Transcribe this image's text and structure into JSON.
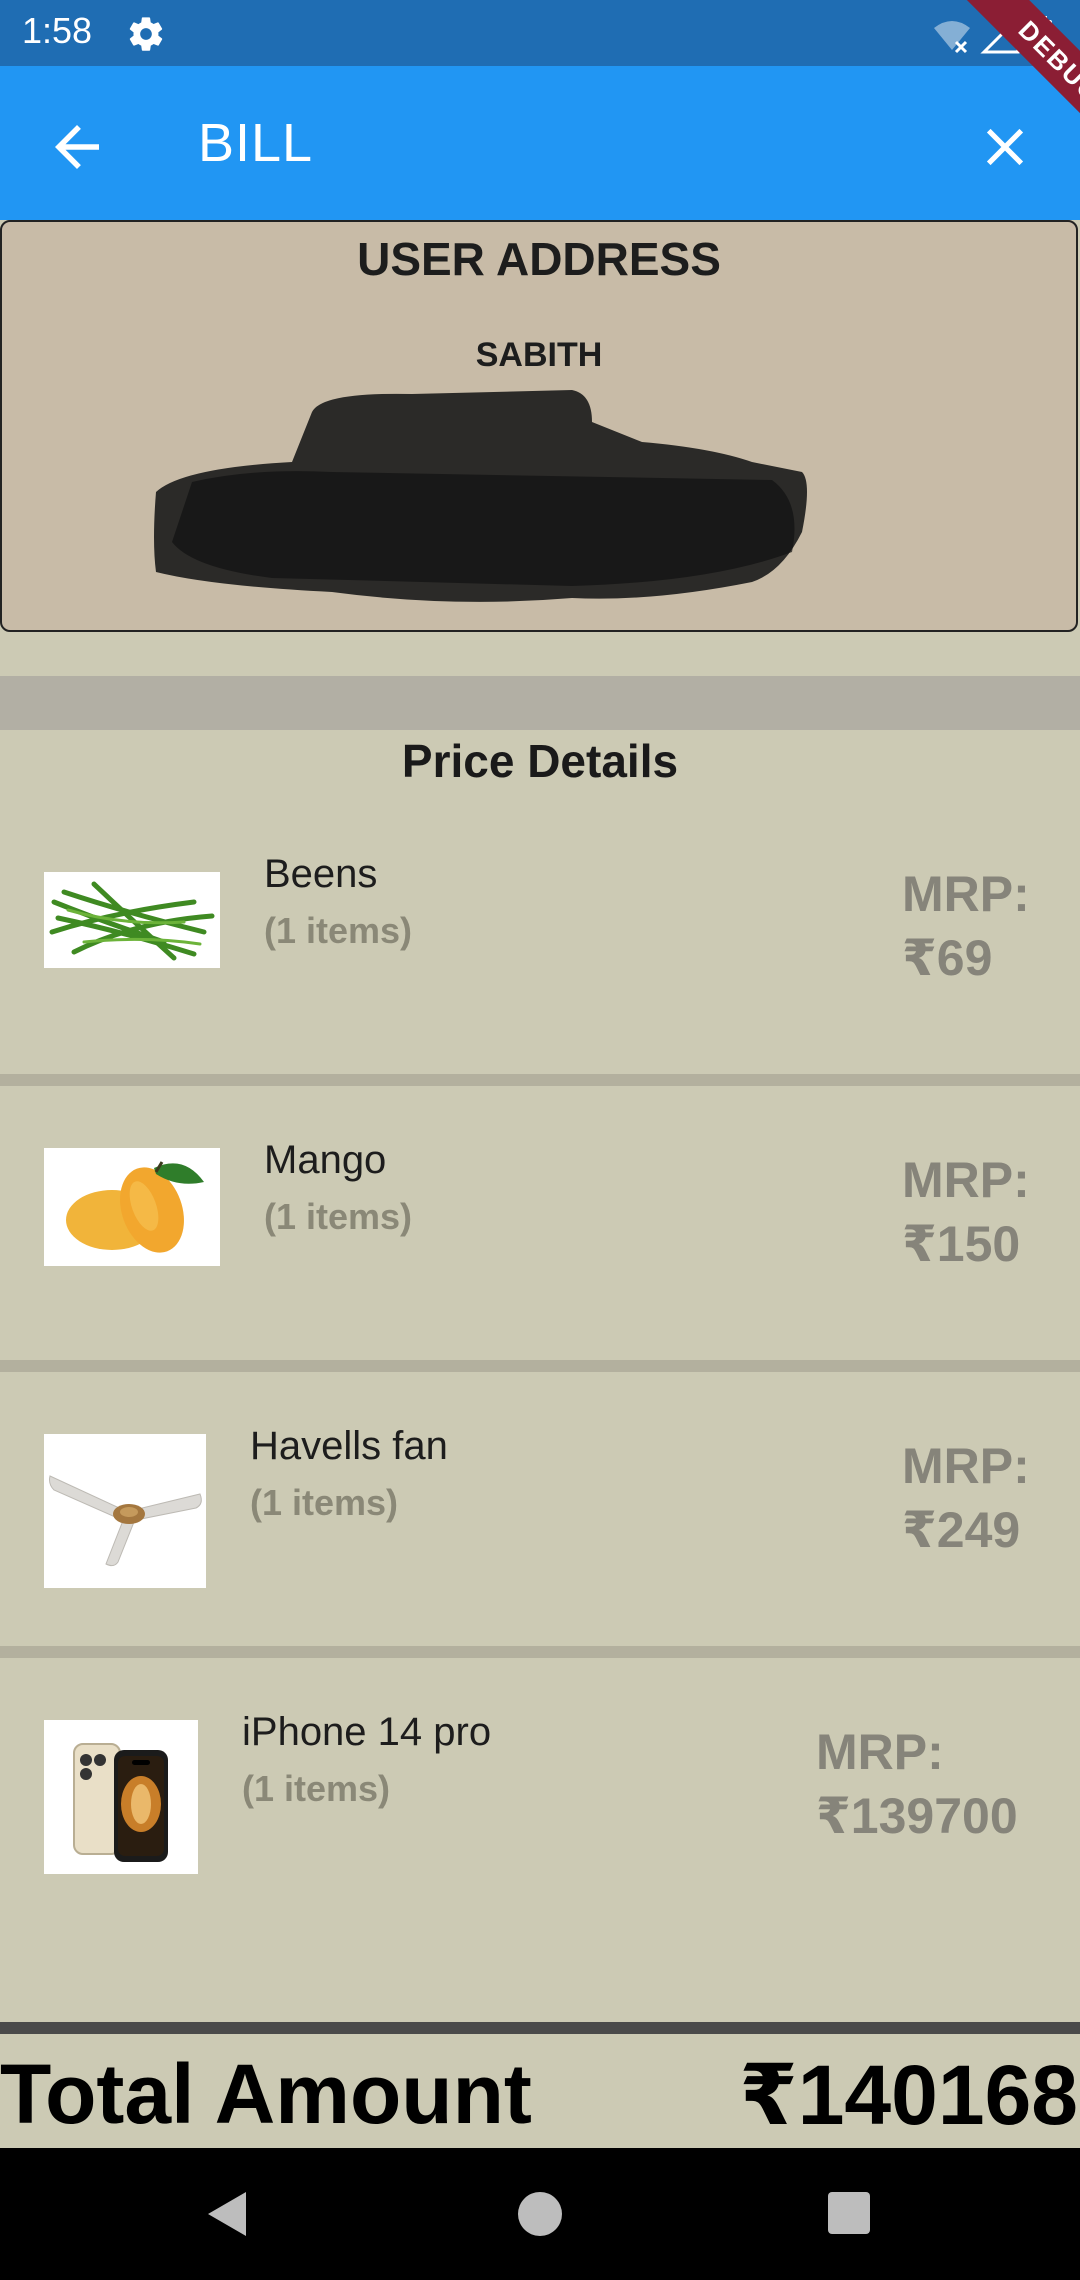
{
  "status_bar": {
    "time": "1:58"
  },
  "app_bar": {
    "title": "BILL",
    "debug_label": "DEBUG"
  },
  "address": {
    "heading": "USER ADDRESS",
    "name": "SABITH"
  },
  "price_details": {
    "heading": "Price Details",
    "items": [
      {
        "name": "Beens",
        "qty": "(1 items)",
        "mrp_label": "MRP:",
        "price": "₹69",
        "thumb_icon": "green-beans-image"
      },
      {
        "name": "Mango",
        "qty": "(1 items)",
        "mrp_label": "MRP:",
        "price": "₹150",
        "thumb_icon": "mango-image"
      },
      {
        "name": "Havells fan",
        "qty": "(1 items)",
        "mrp_label": "MRP:",
        "price": "₹249",
        "thumb_icon": "ceiling-fan-image"
      },
      {
        "name": "iPhone 14 pro",
        "qty": "(1 items)",
        "mrp_label": "MRP:",
        "price": "₹139700",
        "thumb_icon": "iphone-image"
      }
    ]
  },
  "total": {
    "label": "Total Amount",
    "value": "₹140168"
  },
  "colors": {
    "status_bar": "#1f6db3",
    "app_bar": "#2196f3",
    "background": "#cccab4",
    "address_card": "#c8bba7",
    "mrp_text": "#86847a",
    "debug_ribbon": "#8b1e34"
  }
}
